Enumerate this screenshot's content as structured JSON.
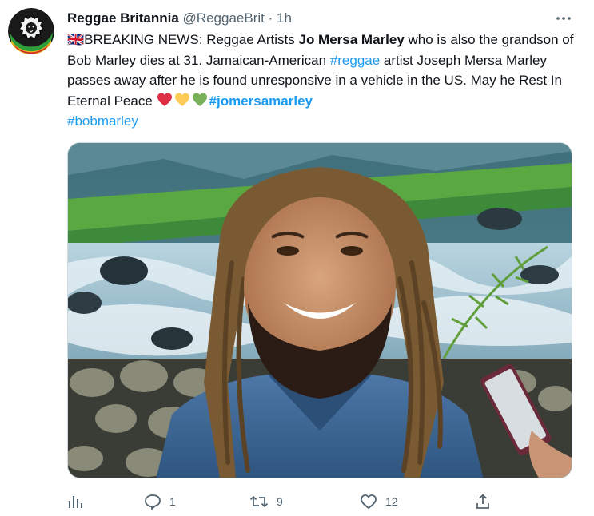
{
  "tweet": {
    "author_name": "Reggae Britannia",
    "author_handle": "@ReggaeBrit",
    "separator": "·",
    "time": "1h",
    "text": {
      "flag": "🇬🇧",
      "part1": "BREAKING NEWS: Reggae Artists ",
      "bold_name": "Jo Mersa Marley",
      "part2": " who is also the grandson of Bob Marley dies at 31. Jamaican-American ",
      "hashtag_reggae": "#reggae",
      "part3": " artist Joseph Mersa Marley passes away after he is found unresponsive in a vehicle in the US. May he Rest In Eternal Peace ",
      "hashtag_jomersamarley": "#jomersamarley",
      "hashtag_bobmarley": "#bobmarley"
    },
    "emojis": [
      "red-heart",
      "yellow-heart",
      "green-heart"
    ],
    "media_description_icon": "photo",
    "actions": {
      "analytics": "",
      "replies": "1",
      "retweets": "9",
      "likes": "12",
      "share": ""
    }
  },
  "colors": {
    "text": "#0f1419",
    "secondary": "#536471",
    "link": "#1d9bf0",
    "heart_red": "#e0245e",
    "heart_yellow": "#ffcc4d",
    "heart_green": "#78b159"
  }
}
